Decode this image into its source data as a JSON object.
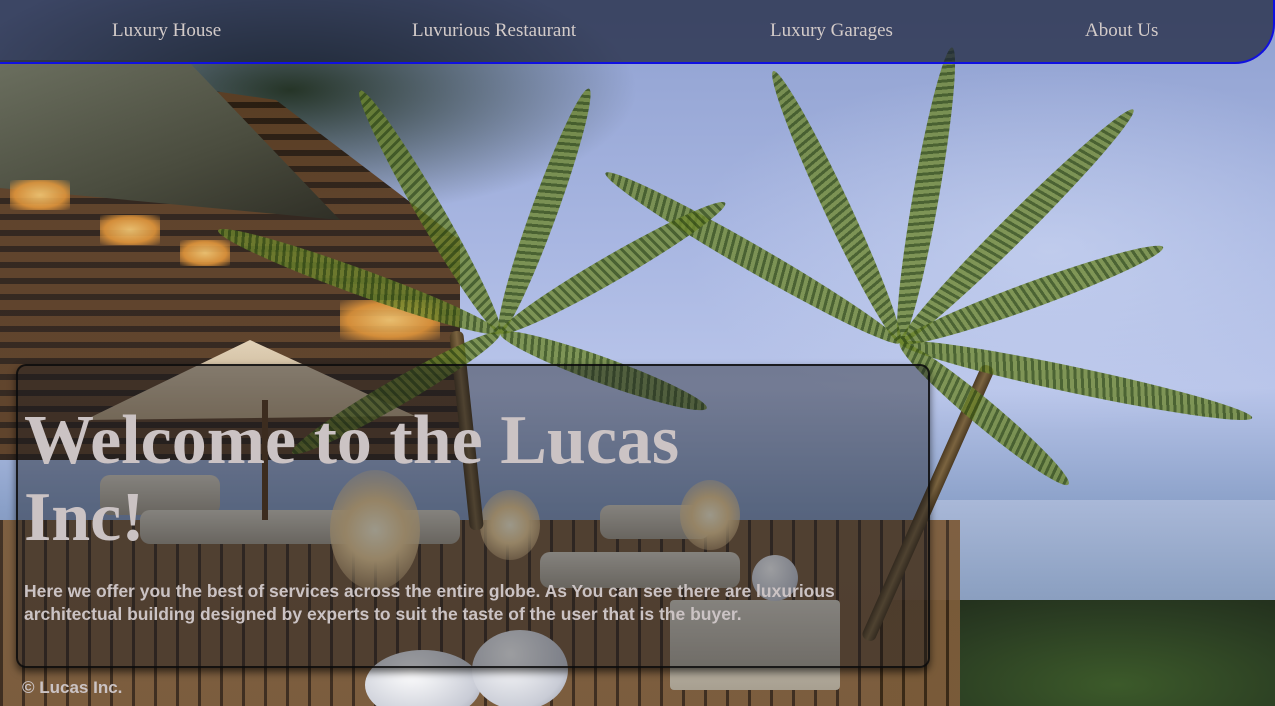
{
  "nav": {
    "items": [
      {
        "label": "Luxury House"
      },
      {
        "label": "Luvurious Restaurant"
      },
      {
        "label": "Luxury Garages"
      },
      {
        "label": "About Us"
      }
    ]
  },
  "hero": {
    "title": "Welcome to the Lucas Inc!",
    "description": "Here we offer you the best of services across the entire globe. As You can see there are luxurious architectual building designed by experts to suit the taste of the user that is the buyer."
  },
  "footer": {
    "copyright": "© Lucas Inc."
  },
  "colors": {
    "nav_border": "#1010e0",
    "text": "#cbc3c4",
    "nav_text": "#d3cbc9"
  }
}
